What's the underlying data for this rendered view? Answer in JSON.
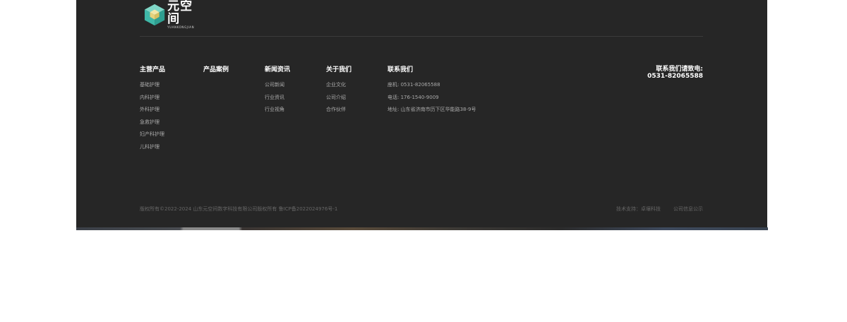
{
  "logo": {
    "name_cn": "元空间",
    "name_en": "YUANKONGJIAN"
  },
  "columns": [
    {
      "title": "主营产品",
      "links": [
        "基础护理",
        "内科护理",
        "外科护理",
        "急救护理",
        "妇产科护理",
        "儿科护理"
      ]
    },
    {
      "title": "产品案例",
      "links": []
    },
    {
      "title": "新闻资讯",
      "links": [
        "公司新闻",
        "行业资讯",
        "行业视角"
      ]
    },
    {
      "title": "关于我们",
      "links": [
        "企业文化",
        "公司介绍",
        "合作伙伴"
      ]
    },
    {
      "title": "联系我们",
      "links": [
        "座机: 0531-82065588",
        "电话: 176-1540-9009",
        "地址: 山东省济南市历下区华能路38-9号"
      ]
    }
  ],
  "hotline": {
    "label": "联系我们请致电:",
    "number": "0531-82065588"
  },
  "bottom": {
    "copyright": "版权所有©2022-2024 山东元空间数字科技有限公司版权所有 鲁ICP备2022024976号-1",
    "tech_support": "技术支持：卓壤科技",
    "company_info": "公司信息公示"
  },
  "colors": {
    "footer_bg": "#262626",
    "logo_teal": "#3fb8a8",
    "text_title": "#ffffff",
    "text_link": "#a9a9a9",
    "text_muted": "#666666"
  }
}
